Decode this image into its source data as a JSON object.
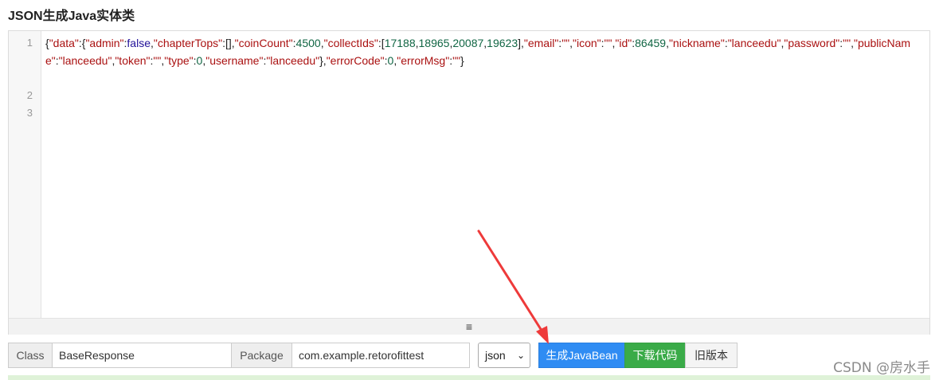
{
  "page_title": "JSON生成Java实体类",
  "editor": {
    "line_numbers": [
      "1",
      "2",
      "3"
    ],
    "segments": [
      {
        "t": "{",
        "c": "plain"
      },
      {
        "t": "\"data\"",
        "c": "str"
      },
      {
        "t": ":{",
        "c": "plain"
      },
      {
        "t": "\"admin\"",
        "c": "str"
      },
      {
        "t": ":",
        "c": "plain"
      },
      {
        "t": "false",
        "c": "kw"
      },
      {
        "t": ",",
        "c": "plain"
      },
      {
        "t": "\"chapterTops\"",
        "c": "str"
      },
      {
        "t": ":[],",
        "c": "plain"
      },
      {
        "t": "\"coinCount\"",
        "c": "str"
      },
      {
        "t": ":",
        "c": "plain"
      },
      {
        "t": "4500",
        "c": "num"
      },
      {
        "t": ",",
        "c": "plain"
      },
      {
        "t": "\"collectIds\"",
        "c": "str"
      },
      {
        "t": ":[",
        "c": "plain"
      },
      {
        "t": "17188",
        "c": "num"
      },
      {
        "t": ",",
        "c": "plain"
      },
      {
        "t": "18965",
        "c": "num"
      },
      {
        "t": ",",
        "c": "plain"
      },
      {
        "t": "20087",
        "c": "num"
      },
      {
        "t": ",",
        "c": "plain"
      },
      {
        "t": "19623",
        "c": "num"
      },
      {
        "t": "],",
        "c": "plain"
      },
      {
        "t": "\"email\"",
        "c": "str"
      },
      {
        "t": ":",
        "c": "plain"
      },
      {
        "t": "\"\"",
        "c": "str"
      },
      {
        "t": ",",
        "c": "plain"
      },
      {
        "t": "\"icon\"",
        "c": "str"
      },
      {
        "t": ":",
        "c": "plain"
      },
      {
        "t": "\"\"",
        "c": "str"
      },
      {
        "t": ",",
        "c": "plain"
      },
      {
        "t": "\"id\"",
        "c": "str"
      },
      {
        "t": ":",
        "c": "plain"
      },
      {
        "t": "86459",
        "c": "num"
      },
      {
        "t": ",",
        "c": "plain"
      },
      {
        "t": "\"nickname\"",
        "c": "str"
      },
      {
        "t": ":",
        "c": "plain"
      },
      {
        "t": "\"lanceedu\"",
        "c": "str"
      },
      {
        "t": ",",
        "c": "plain"
      },
      {
        "t": "\"password\"",
        "c": "str"
      },
      {
        "t": ":",
        "c": "plain"
      },
      {
        "t": "\"\"",
        "c": "str"
      },
      {
        "t": ",",
        "c": "plain"
      },
      {
        "t": "\"publicName\"",
        "c": "str"
      },
      {
        "t": ":",
        "c": "plain"
      },
      {
        "t": "\"lanceedu\"",
        "c": "str"
      },
      {
        "t": ",",
        "c": "plain"
      },
      {
        "t": "\"token\"",
        "c": "str"
      },
      {
        "t": ":",
        "c": "plain"
      },
      {
        "t": "\"\"",
        "c": "str"
      },
      {
        "t": ",",
        "c": "plain"
      },
      {
        "t": "\"type\"",
        "c": "str"
      },
      {
        "t": ":",
        "c": "plain"
      },
      {
        "t": "0",
        "c": "num"
      },
      {
        "t": ",",
        "c": "plain"
      },
      {
        "t": "\"username\"",
        "c": "str"
      },
      {
        "t": ":",
        "c": "plain"
      },
      {
        "t": "\"lanceedu\"",
        "c": "str"
      },
      {
        "t": "},",
        "c": "plain"
      },
      {
        "t": "\"errorCode\"",
        "c": "str"
      },
      {
        "t": ":",
        "c": "plain"
      },
      {
        "t": "0",
        "c": "num"
      },
      {
        "t": ",",
        "c": "plain"
      },
      {
        "t": "\"errorMsg\"",
        "c": "str"
      },
      {
        "t": ":",
        "c": "plain"
      },
      {
        "t": "\"\"",
        "c": "str"
      },
      {
        "t": "}",
        "c": "plain"
      }
    ],
    "resize_handle_icon": "hamburger-icon",
    "resize_glyph": "≡"
  },
  "toolbar": {
    "class_label": "Class",
    "class_value": "BaseResponse",
    "package_label": "Package",
    "package_value": "com.example.retorofittest",
    "format_selected": "json",
    "generate_label": "生成JavaBean",
    "download_label": "下载代码",
    "old_version_label": "旧版本"
  },
  "watermark": "CSDN @房水手",
  "colors": {
    "primary_button": "#2f8cf3",
    "success_button": "#3aab48",
    "annotation_arrow": "#ee3a3a",
    "json_string": "#aa1111",
    "json_number": "#116644",
    "json_keyword": "#221199"
  }
}
